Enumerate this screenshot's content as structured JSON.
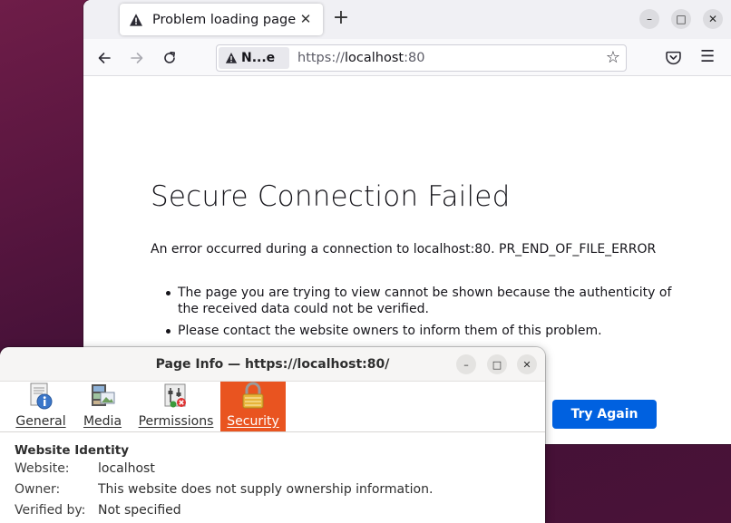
{
  "browser": {
    "tab": {
      "title": "Problem loading page",
      "close": "✕"
    },
    "new_tab": "+",
    "window_controls": {
      "minimize": "–",
      "maximize": "□",
      "close": "✕"
    },
    "toolbar": {
      "identity_label": "N...e",
      "url_scheme": "https://",
      "url_host": "localhost",
      "url_port": ":80"
    },
    "page": {
      "title": "Secure Connection Failed",
      "description": "An error occurred during a connection to localhost:80. PR_END_OF_FILE_ERROR",
      "bullets": [
        "The page you are trying to view cannot be shown because the authenticity of the received data could not be verified.",
        "Please contact the website owners to inform them of this problem."
      ],
      "try_again": "Try Again"
    }
  },
  "dialog": {
    "title": "Page Info — https://localhost:80/",
    "controls": {
      "minimize": "–",
      "maximize": "□",
      "close": "✕"
    },
    "tabs": [
      {
        "label": "General",
        "icon": "info-document-icon"
      },
      {
        "label": "Media",
        "icon": "film-media-icon"
      },
      {
        "label": "Permissions",
        "icon": "permissions-switch-icon"
      },
      {
        "label": "Security",
        "icon": "padlock-icon",
        "active": true
      }
    ],
    "section_title": "Website Identity",
    "rows": [
      {
        "label": "Website:",
        "value": "localhost"
      },
      {
        "label": "Owner:",
        "value": "This website does not supply ownership information."
      },
      {
        "label": "Verified by:",
        "value": "Not specified"
      }
    ]
  },
  "colors": {
    "desktop": "#5a1640",
    "primary_button": "#0061e0",
    "active_tab": "#e95420"
  }
}
